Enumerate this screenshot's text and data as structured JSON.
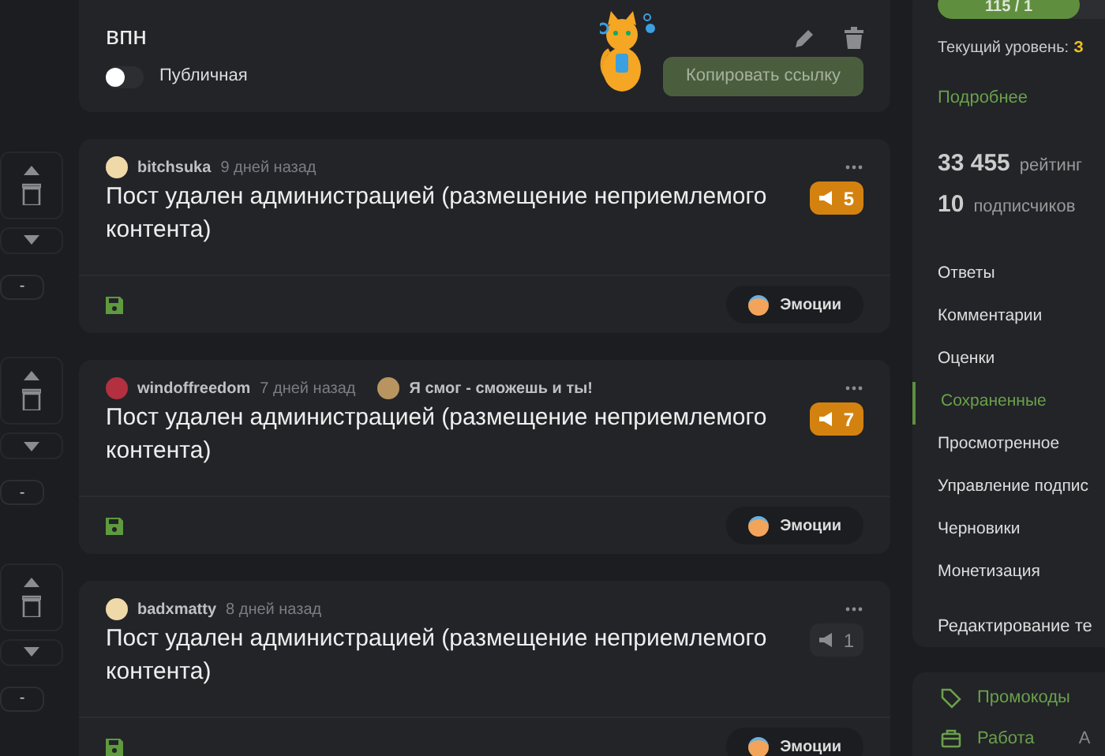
{
  "community": {
    "title": "впн",
    "public": false,
    "public_label": "Публичная",
    "copy_button": "Копировать ссылку"
  },
  "posts": [
    {
      "author": "bitchsuka",
      "time": "9 дней назад",
      "title": "Пост удален администрацией (размещение неприемлемого контента)",
      "reports": "5",
      "hot": true,
      "saved": true,
      "emotions": "Эмоции",
      "rating": "-"
    },
    {
      "author": "windoffreedom",
      "time": "7 дней назад",
      "badge": "Я смог - сможешь и ты!",
      "title": "Пост удален администрацией (размещение неприемлемого контента)",
      "reports": "7",
      "hot": true,
      "saved": true,
      "emotions": "Эмоции",
      "rating": "-"
    },
    {
      "author": "badxmatty",
      "time": "8 дней назад",
      "title": "Пост удален администрацией (размещение неприемлемого контента)",
      "reports": "1",
      "hot": false,
      "saved": true,
      "emotions": "Эмоции",
      "rating": "-"
    }
  ],
  "sidebar": {
    "progress": {
      "text": "115 / 1",
      "level": 0.64
    },
    "level_label": "Текущий уровень:",
    "level_value": "З",
    "more_link": "Подробнее",
    "stats": [
      {
        "value": "33 455",
        "label": "рейтинг"
      },
      {
        "value": "10",
        "label": "подписчиков"
      }
    ],
    "menu": [
      {
        "label": "Ответы",
        "selected": false
      },
      {
        "label": "Комментарии",
        "selected": false
      },
      {
        "label": "Оценки",
        "selected": false
      },
      {
        "label": "Сохраненные",
        "selected": true
      },
      {
        "label": "Просмотренное",
        "selected": false
      },
      {
        "label": "Управление подпис",
        "selected": false
      },
      {
        "label": "Черновики",
        "selected": false
      },
      {
        "label": "Монетизация",
        "selected": false
      }
    ],
    "edit_link": "Редактирование те",
    "links": [
      {
        "kind": "tag",
        "label": "Промокоды"
      },
      {
        "kind": "work",
        "label": "Работа",
        "extra": "А"
      }
    ]
  }
}
